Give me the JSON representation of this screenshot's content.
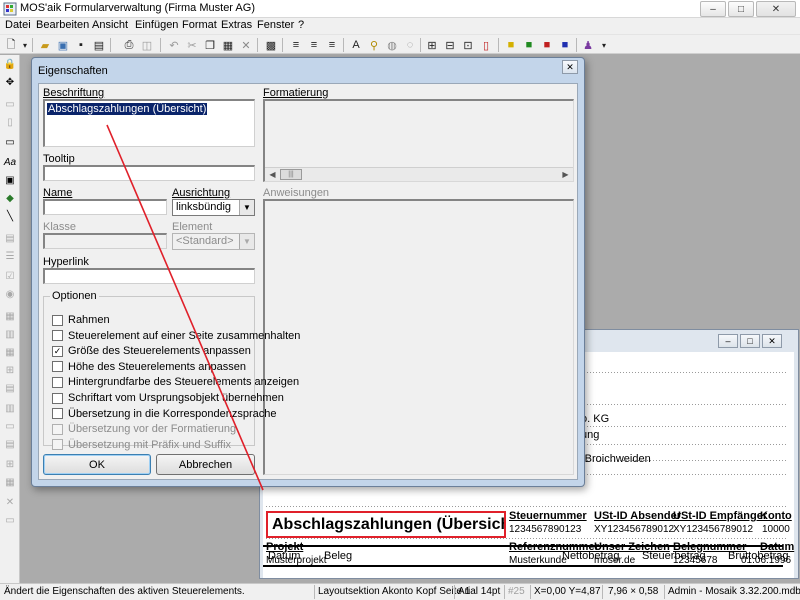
{
  "app": {
    "title": "MOS'aik Formularverwaltung (Firma Muster AG)",
    "window_buttons": [
      "–",
      "□",
      "✕"
    ]
  },
  "menu": [
    "Datei",
    "Bearbeiten",
    "Ansicht",
    "Einfügen",
    "Format",
    "Extras",
    "Fenster",
    "?"
  ],
  "toolbar_icons": [
    "new-document-icon",
    "open-folder-icon",
    "open-file-icon",
    "save-icon",
    "print-icon",
    "print-preview-icon",
    "undo-icon",
    "cut-icon",
    "copy-icon",
    "paste-icon",
    "delete-icon",
    "properties-icon",
    "align-left-icon",
    "align-center-icon",
    "align-right-icon",
    "font-icon",
    "zoom-icon",
    "grid-icon",
    "snap-icon",
    "group-icon",
    "ungroup-icon",
    "bring-front-icon",
    "send-back-icon",
    "lock-yellow-icon",
    "lock-green-icon",
    "lock-red-icon",
    "lock-blue-icon",
    "users-icon"
  ],
  "dialog": {
    "title": "Eigenschaften",
    "close": "✕",
    "labels": {
      "beschriftung": "Beschriftung",
      "formatierung": "Formatierung",
      "tooltip": "Tooltip",
      "name": "Name",
      "ausrichtung": "Ausrichtung",
      "anweisungen": "Anweisungen",
      "klasse": "Klasse",
      "element": "Element",
      "hyperlink": "Hyperlink",
      "optionen": "Optionen"
    },
    "beschriftung_value": "Abschlagszahlungen (Übersicht)",
    "ausrichtung_value": "linksbündig",
    "element_value": "<Standard>",
    "options": [
      {
        "label": "Rahmen",
        "checked": false,
        "enabled": true
      },
      {
        "label": "Steuerelement auf einer Seite zusammenhalten",
        "checked": false,
        "enabled": true
      },
      {
        "label": "Größe des Steuerelements anpassen",
        "checked": true,
        "enabled": true
      },
      {
        "label": "Höhe des Steuerelements anpassen",
        "checked": false,
        "enabled": true
      },
      {
        "label": "Hintergrundfarbe des Steuerelements anzeigen",
        "checked": false,
        "enabled": true
      },
      {
        "label": "Schriftart vom Ursprungsobjekt übernehmen",
        "checked": false,
        "enabled": true
      },
      {
        "label": "Übersetzung in die Korrespondenzsprache",
        "checked": false,
        "enabled": true
      },
      {
        "label": "Übersetzung vor der Formatierung",
        "checked": false,
        "enabled": false
      },
      {
        "label": "Übersetzung mit Präfix und Suffix",
        "checked": false,
        "enabled": false
      }
    ],
    "ok_button": "OK",
    "cancel_button": "Abbrechen"
  },
  "form": {
    "partial_lines": [
      "o. KG",
      "ung",
      "-Broichweiden"
    ],
    "title": "Abschlagszahlungen (Übersicht)",
    "header_row1": [
      "Steuernummer",
      "USt-ID Absender",
      "USt-ID Empfänger",
      "Konto"
    ],
    "values_row1": [
      "1234567890123",
      "XY123456789012",
      "XY123456789012",
      "10000"
    ],
    "header_row2": [
      "Projekt",
      "Referenznummer",
      "Unser Zeichen",
      "Belegnummer",
      "Datum"
    ],
    "values_row2": [
      "Musterprojekt",
      "Musterkunde",
      "moser.de",
      "12345678",
      "01.06.1996"
    ],
    "table_header": [
      "Datum",
      "Beleg",
      "Nettobetrag",
      "Steuerbetrag",
      "Bruttobetrag"
    ]
  },
  "status": {
    "message": "Ändert die Eigenschaften des aktiven Steuerelements.",
    "section": "Layoutsektion Akonto Kopf Seite 1",
    "font": "Arial 14pt",
    "count": "#25",
    "position": "X=0,00 Y=4,87",
    "size": "7,96 × 0,58",
    "db": "Admin - Mosaik 3.32.200.mdb"
  },
  "colors": {
    "highlight": "#e0202a",
    "selection": "#0a246a",
    "dialog_frame": "#c3d5ea"
  }
}
